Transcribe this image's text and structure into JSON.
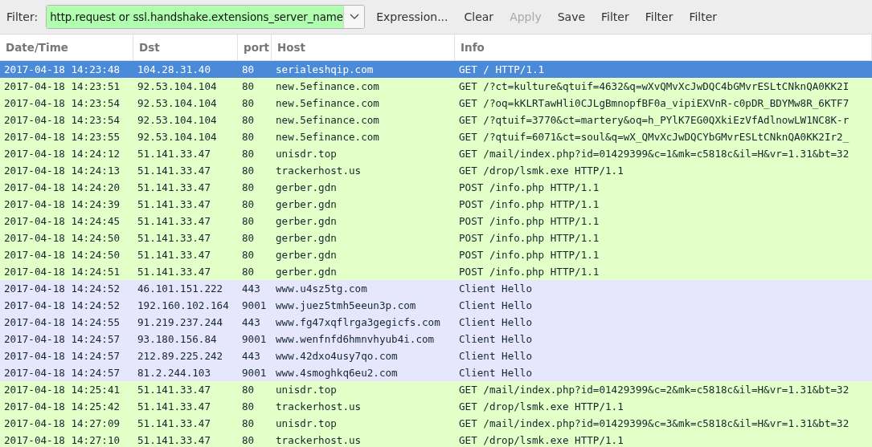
{
  "toolbar": {
    "filter_label": "Filter:",
    "filter_value": "http.request or ssl.handshake.extensions_server_name",
    "buttons": [
      {
        "label": "Expression...",
        "disabled": false
      },
      {
        "label": "Clear",
        "disabled": false
      },
      {
        "label": "Apply",
        "disabled": true
      },
      {
        "label": "Save",
        "disabled": false
      },
      {
        "label": "Filter",
        "disabled": false
      },
      {
        "label": "Filter",
        "disabled": false
      },
      {
        "label": "Filter",
        "disabled": false
      }
    ]
  },
  "table": {
    "columns": [
      "Date/Time",
      "Dst",
      "port",
      "Host",
      "Info"
    ],
    "rows": [
      {
        "kind": "http",
        "selected": true,
        "cells": [
          "2017-04-18 14:23:48",
          "104.28.31.40",
          "80",
          "serialeshqip.com",
          "GET / HTTP/1.1"
        ]
      },
      {
        "kind": "http",
        "selected": false,
        "cells": [
          "2017-04-18 14:23:51",
          "92.53.104.104",
          "80",
          "new.5efinance.com",
          "GET /?ct=kulture&qtuif=4632&q=wXvQMvXcJwDQC4bGMvrESLtCNknQA0KK2I"
        ]
      },
      {
        "kind": "http",
        "selected": false,
        "cells": [
          "2017-04-18 14:23:54",
          "92.53.104.104",
          "80",
          "new.5efinance.com",
          "GET /?oq=kKLRTawHli0CJLgBmnopfBF0a_vipiEXVnR-c0pDR_BDYMw8R_6KTF7"
        ]
      },
      {
        "kind": "http",
        "selected": false,
        "cells": [
          "2017-04-18 14:23:54",
          "92.53.104.104",
          "80",
          "new.5efinance.com",
          "GET /?qtuif=3770&ct=martery&oq=h_PYlK7EG0QXkiEzVfAdlnowLW1NC8K-r"
        ]
      },
      {
        "kind": "http",
        "selected": false,
        "cells": [
          "2017-04-18 14:23:55",
          "92.53.104.104",
          "80",
          "new.5efinance.com",
          "GET /?qtuif=6071&ct=soul&q=wX_QMvXcJwDQCYbGMvrESLtCNknQA0KK2Ir2_"
        ]
      },
      {
        "kind": "http",
        "selected": false,
        "cells": [
          "2017-04-18 14:24:12",
          "51.141.33.47",
          "80",
          "unisdr.top",
          "GET /mail/index.php?id=01429399&c=1&mk=c5818c&il=H&vr=1.31&bt=32"
        ]
      },
      {
        "kind": "http",
        "selected": false,
        "cells": [
          "2017-04-18 14:24:13",
          "51.141.33.47",
          "80",
          "trackerhost.us",
          "GET /drop/lsmk.exe HTTP/1.1"
        ]
      },
      {
        "kind": "http",
        "selected": false,
        "cells": [
          "2017-04-18 14:24:20",
          "51.141.33.47",
          "80",
          "gerber.gdn",
          "POST /info.php HTTP/1.1"
        ]
      },
      {
        "kind": "http",
        "selected": false,
        "cells": [
          "2017-04-18 14:24:39",
          "51.141.33.47",
          "80",
          "gerber.gdn",
          "POST /info.php HTTP/1.1"
        ]
      },
      {
        "kind": "http",
        "selected": false,
        "cells": [
          "2017-04-18 14:24:45",
          "51.141.33.47",
          "80",
          "gerber.gdn",
          "POST /info.php HTTP/1.1"
        ]
      },
      {
        "kind": "http",
        "selected": false,
        "cells": [
          "2017-04-18 14:24:50",
          "51.141.33.47",
          "80",
          "gerber.gdn",
          "POST /info.php HTTP/1.1"
        ]
      },
      {
        "kind": "http",
        "selected": false,
        "cells": [
          "2017-04-18 14:24:50",
          "51.141.33.47",
          "80",
          "gerber.gdn",
          "POST /info.php HTTP/1.1"
        ]
      },
      {
        "kind": "http",
        "selected": false,
        "cells": [
          "2017-04-18 14:24:51",
          "51.141.33.47",
          "80",
          "gerber.gdn",
          "POST /info.php HTTP/1.1"
        ]
      },
      {
        "kind": "tls",
        "selected": false,
        "cells": [
          "2017-04-18 14:24:52",
          "46.101.151.222",
          "443",
          "www.u4sz5tg.com",
          "Client Hello"
        ]
      },
      {
        "kind": "tls",
        "selected": false,
        "cells": [
          "2017-04-18 14:24:52",
          "192.160.102.164",
          "9001",
          "www.juez5tmh5eeun3p.com",
          "Client Hello"
        ]
      },
      {
        "kind": "tls",
        "selected": false,
        "cells": [
          "2017-04-18 14:24:55",
          "91.219.237.244",
          "443",
          "www.fg47xqflrga3gegicfs.com",
          "Client Hello"
        ]
      },
      {
        "kind": "tls",
        "selected": false,
        "cells": [
          "2017-04-18 14:24:57",
          "93.180.156.84",
          "9001",
          "www.wenfnfd6hmnvhyub4i.com",
          "Client Hello"
        ]
      },
      {
        "kind": "tls",
        "selected": false,
        "cells": [
          "2017-04-18 14:24:57",
          "212.89.225.242",
          "443",
          "www.42dxo4usy7qo.com",
          "Client Hello"
        ]
      },
      {
        "kind": "tls",
        "selected": false,
        "cells": [
          "2017-04-18 14:24:57",
          "81.2.244.103",
          "9001",
          "www.4smoghkq6eu2.com",
          "Client Hello"
        ]
      },
      {
        "kind": "http",
        "selected": false,
        "cells": [
          "2017-04-18 14:25:41",
          "51.141.33.47",
          "80",
          "unisdr.top",
          "GET /mail/index.php?id=01429399&c=2&mk=c5818c&il=H&vr=1.31&bt=32"
        ]
      },
      {
        "kind": "http",
        "selected": false,
        "cells": [
          "2017-04-18 14:25:42",
          "51.141.33.47",
          "80",
          "trackerhost.us",
          "GET /drop/lsmk.exe HTTP/1.1"
        ]
      },
      {
        "kind": "http",
        "selected": false,
        "cells": [
          "2017-04-18 14:27:09",
          "51.141.33.47",
          "80",
          "unisdr.top",
          "GET /mail/index.php?id=01429399&c=3&mk=c5818c&il=H&vr=1.31&bt=32"
        ]
      },
      {
        "kind": "http",
        "selected": false,
        "cells": [
          "2017-04-18 14:27:10",
          "51.141.33.47",
          "80",
          "trackerhost.us",
          "GET /drop/lsmk.exe HTTP/1.1"
        ]
      }
    ]
  }
}
